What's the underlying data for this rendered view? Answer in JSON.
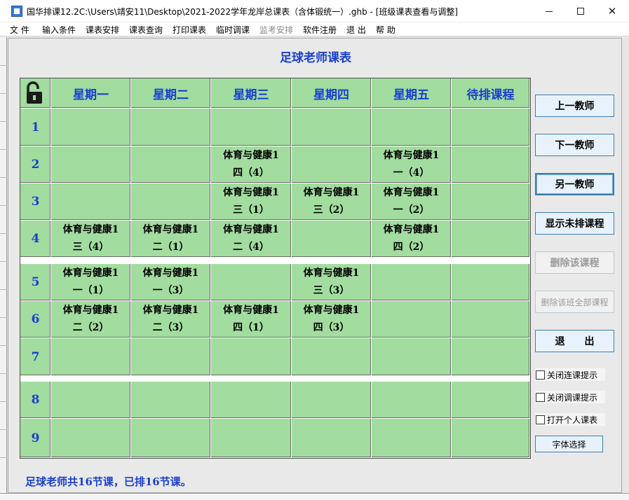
{
  "window": {
    "title": "国华排课12.2C:\\Users\\靖安11\\Desktop\\2021-2022学年龙岸总课表（含体锻统一）.ghb - [班级课表查看与调整]"
  },
  "menu": [
    {
      "label": "文 件",
      "disabled": false
    },
    {
      "label": "输入条件",
      "disabled": false
    },
    {
      "label": "课表安排",
      "disabled": false
    },
    {
      "label": "课表查询",
      "disabled": false
    },
    {
      "label": "打印课表",
      "disabled": false
    },
    {
      "label": "临时调课",
      "disabled": false
    },
    {
      "label": "监考安排",
      "disabled": true
    },
    {
      "label": "软件注册",
      "disabled": false
    },
    {
      "label": "退 出",
      "disabled": false
    },
    {
      "label": "帮 助",
      "disabled": false
    }
  ],
  "form": {
    "title": "足球老师课表",
    "summary": "足球老师共16节课，已排16节课。"
  },
  "timetable": {
    "headers": [
      "星期一",
      "星期二",
      "星期三",
      "星期四",
      "星期五",
      "待排课程"
    ],
    "periods": [
      "1",
      "2",
      "3",
      "4",
      "5",
      "6",
      "7",
      "8",
      "9"
    ],
    "rows": [
      [
        [],
        [],
        [],
        [],
        [],
        []
      ],
      [
        [],
        [],
        [
          "体育与健康1",
          "四（4）"
        ],
        [],
        [
          "体育与健康1",
          "一（4）"
        ],
        []
      ],
      [
        [],
        [],
        [
          "体育与健康1",
          "三（1）"
        ],
        [
          "体育与健康1",
          "三（2）"
        ],
        [
          "体育与健康1",
          "一（2）"
        ],
        []
      ],
      [
        [
          "体育与健康1",
          "三（4）"
        ],
        [
          "体育与健康1",
          "二（1）"
        ],
        [
          "体育与健康1",
          "二（4）"
        ],
        [],
        [
          "体育与健康1",
          "四（2）"
        ],
        []
      ],
      [
        [
          "体育与健康1",
          "一（1）"
        ],
        [
          "体育与健康1",
          "一（3）"
        ],
        [],
        [
          "体育与健康1",
          "三（3）"
        ],
        [],
        []
      ],
      [
        [
          "体育与健康1",
          "二（2）"
        ],
        [
          "体育与健康1",
          "二（3）"
        ],
        [
          "体育与健康1",
          "四（1）"
        ],
        [
          "体育与健康1",
          "四（3）"
        ],
        [],
        []
      ],
      [
        [],
        [],
        [],
        [],
        [],
        []
      ],
      [
        [],
        [],
        [],
        [],
        [],
        []
      ],
      [
        [],
        [],
        [],
        [],
        [],
        []
      ]
    ]
  },
  "buttons": {
    "prev_teacher": "上一教师",
    "next_teacher": "下一教师",
    "other_teacher": "另一教师",
    "show_unscheduled": "显示未排课程",
    "delete_course": "删除该课程",
    "delete_all_class": "删除该班全部课程",
    "exit": "退　　出",
    "font_select": "字体选择"
  },
  "checkboxes": {
    "close_consecutive": "关闭连课提示",
    "close_adjust": "关闭调课提示",
    "open_personal": "打开个人课表"
  },
  "icons": {
    "lock": "unlocked-padlock-icon"
  },
  "colors": {
    "grid_green": "#a2dc9f",
    "header_blue": "#1a3fd0"
  }
}
